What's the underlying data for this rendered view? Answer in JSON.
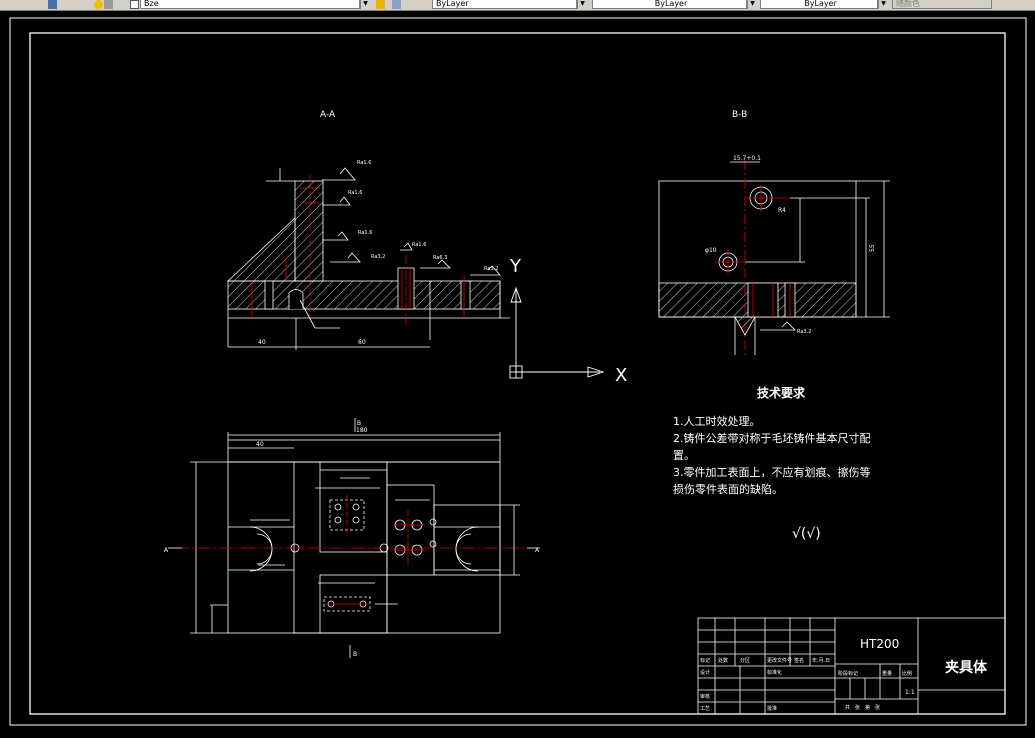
{
  "toolbar": {
    "layer_value": "Bze",
    "color_value": "ByLayer",
    "linetype_value": "ByLayer",
    "lineweight_value": "ByLayer",
    "plotstyle_value": "随颜色"
  },
  "drawing": {
    "section_aa_label": "A-A",
    "section_bb_label": "B-B",
    "ucs_x_label": "X",
    "ucs_y_label": "Y",
    "tech_title": "技术要求",
    "tech_notes": [
      "1.人工时效处理。",
      "2.铸件公差带对称于毛坯铸件基本尺寸配",
      "置。",
      "3.零件加工表面上，不应有划痕、擦伤等",
      "损伤零件表面的缺陷。"
    ],
    "roughness_symbol": "√(√)",
    "material": "HT200",
    "part_name": "夹具体",
    "scale": "1:1",
    "title_cells": {
      "mark": "标记",
      "count": "处数",
      "zone": "分区",
      "doc_no": "更改文件号",
      "sign": "签名",
      "date": "年.月.日",
      "design": "设计",
      "std": "标准化",
      "stage_mark": "阶段标记",
      "weight": "重量",
      "ratio": "比例",
      "review": "审核",
      "process": "工艺",
      "approve": "批准",
      "sheets": "共　张　第　张"
    },
    "dims": {
      "top_total": "180",
      "top_left": "40",
      "aa_left": "40",
      "aa_mid": "60",
      "bb_top": "15.7+0.1",
      "bb_right": "55",
      "bb_hole": "φ10",
      "bb_r": "R4",
      "roughness_a": "Ra1.6",
      "roughness_b": "Ra3.2",
      "roughness_c": "Ra6.3",
      "view_mark_b": "B",
      "view_mark_a": "A"
    }
  }
}
